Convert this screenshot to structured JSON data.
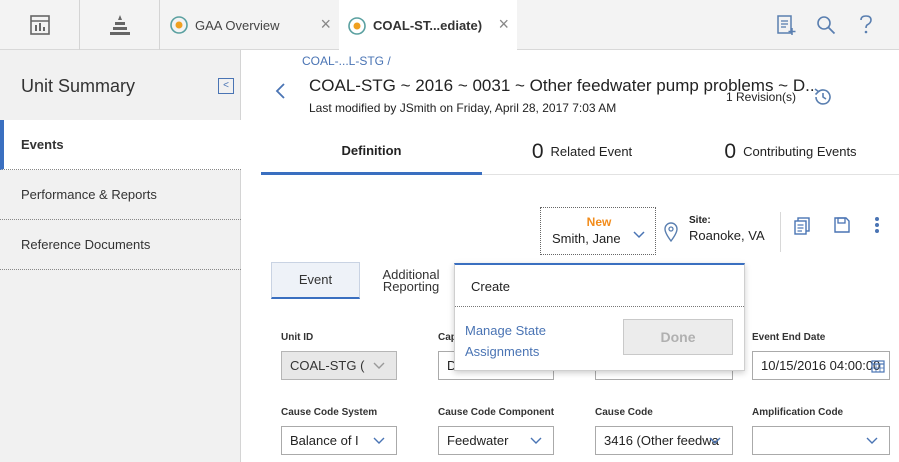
{
  "topbar": {
    "tabs": [
      {
        "label": "GAA Overview",
        "close": "×"
      },
      {
        "label": "COAL-ST...ediate)",
        "close": "×"
      }
    ]
  },
  "sidebar": {
    "title": "Unit Summary",
    "collapse_glyph": "<",
    "items": [
      {
        "label": "Events"
      },
      {
        "label": "Performance & Reports"
      },
      {
        "label": "Reference Documents"
      }
    ]
  },
  "header": {
    "breadcrumb": "COAL-...L-STG /",
    "title": "COAL-STG ~ 2016 ~ 0031 ~ Other feedwater pump problems ~ D..",
    "modified": "Last modified by JSmith on Friday, April 28, 2017 7:03 AM",
    "revisions": "1 Revision(s)"
  },
  "section_tabs": [
    {
      "label": "Definition"
    },
    {
      "count": "0",
      "label": "Related Event"
    },
    {
      "count": "0",
      "label": "Contributing Events"
    }
  ],
  "state": {
    "name": "New",
    "user": "Smith, Jane",
    "site_label": "Site:",
    "site_value": "Roanoke, VA"
  },
  "inner_tabs": [
    {
      "label": "Event"
    },
    {
      "label": "Additional Reporting"
    }
  ],
  "fields": {
    "unit_id": {
      "label": "Unit ID",
      "value": "COAL-STG ("
    },
    "cap": {
      "label": "Cap",
      "value": "D"
    },
    "event_end_date": {
      "label": "Event End Date",
      "value": "10/15/2016 04:00:00"
    },
    "cause_code_system": {
      "label": "Cause Code System",
      "value": "Balance of I"
    },
    "cause_code_component": {
      "label": "Cause Code Component",
      "value": "Feedwater"
    },
    "cause_code": {
      "label": "Cause Code",
      "value": "3416 (Other feedwa"
    },
    "amplification_code": {
      "label": "Amplification Code",
      "value": ""
    }
  },
  "popover": {
    "create": "Create",
    "manage": "Manage State Assignments",
    "done": "Done"
  },
  "colors": {
    "accent": "#3a6fc0",
    "link": "#4a74b4",
    "state_new": "#f28c1b"
  }
}
